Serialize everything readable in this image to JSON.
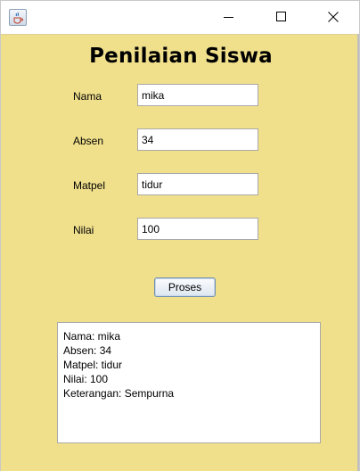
{
  "window": {
    "title": "",
    "min_icon": "minimize-icon",
    "max_icon": "maximize-icon",
    "close_icon": "close-icon",
    "app_icon": "java-cup-icon"
  },
  "form": {
    "heading": "Penilaian Siswa",
    "fields": {
      "nama": {
        "label": "Nama",
        "value": "mika"
      },
      "absen": {
        "label": "Absen",
        "value": "34"
      },
      "matpel": {
        "label": "Matpel",
        "value": "tidur"
      },
      "nilai": {
        "label": "Nilai",
        "value": "100"
      }
    },
    "button_label": "Proses"
  },
  "output": {
    "lines": [
      "Nama: mika",
      "Absen: 34",
      "Matpel: tidur",
      "Nilai: 100",
      "Keterangan: Sempurna"
    ]
  },
  "colors": {
    "background": "#f0e08c"
  }
}
